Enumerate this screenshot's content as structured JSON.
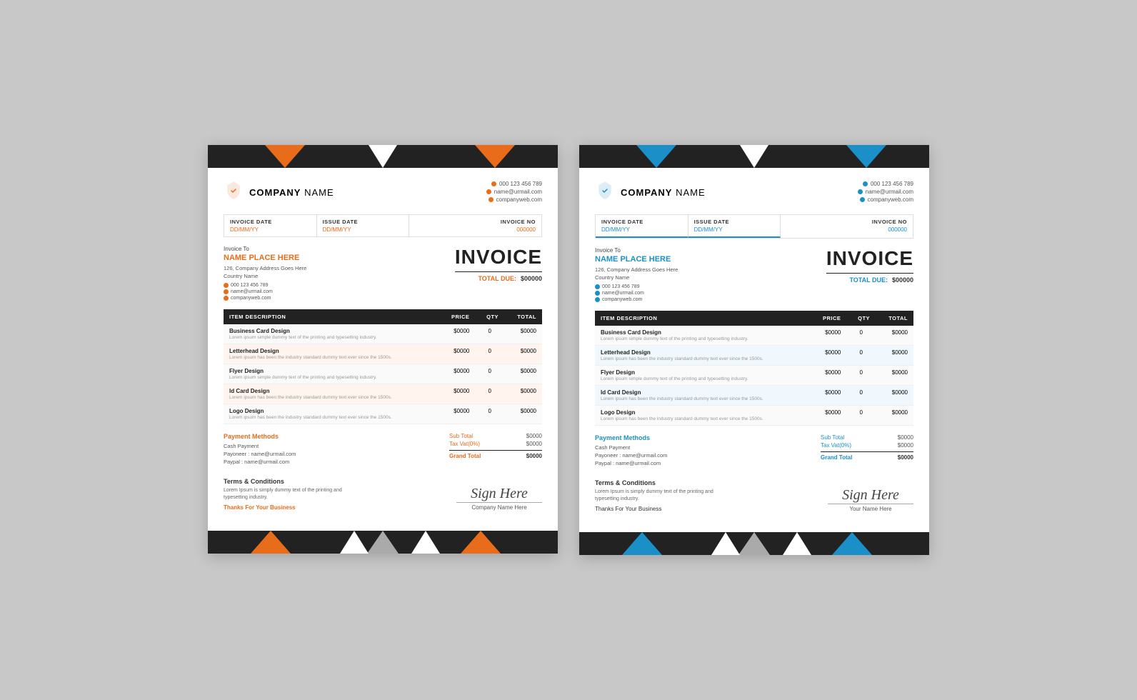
{
  "invoice_orange": {
    "company": {
      "name_bold": "COMPANY",
      "name_light": " NAME",
      "phone": "000 123 456 789",
      "email": "name@urmail.com",
      "web": "companyweb.com"
    },
    "dates": {
      "invoice_date_label": "INVOICE DATE",
      "invoice_date_value": "DD/MM/YY",
      "issue_date_label": "ISSUE DATE",
      "issue_date_value": "DD/MM/YY",
      "invoice_no_label": "INVOICE NO",
      "invoice_no_value": "000000"
    },
    "bill_to": {
      "label": "Invoice To",
      "name": "NAME PLACE HERE",
      "address1": "126, Company Address Goes Here",
      "address2": "Country Name",
      "phone": "000 123 456 789",
      "email": "name@urmail.com",
      "web": "companyweb.com"
    },
    "invoice_title": "INVOICE",
    "total_due_label": "TOTAL DUE:",
    "total_due_value": "$00000",
    "items": [
      {
        "name": "Business Card Design",
        "desc": "Lorem ipsum simple dummy text of the printing and typesetting industry.",
        "price": "$0000",
        "qty": "0",
        "total": "$0000"
      },
      {
        "name": "Letterhead Design",
        "desc": "Lorem ipsum has been the industry standard dummy text ever since the 1500s.",
        "price": "$0000",
        "qty": "0",
        "total": "$0000"
      },
      {
        "name": "Flyer Design",
        "desc": "Lorem ipsum simple dummy text of the printing and typesetting industry.",
        "price": "$0000",
        "qty": "0",
        "total": "$0000"
      },
      {
        "name": "Id Card Design",
        "desc": "Lorem ipsum has been the industry standard dummy text ever since the 1500s.",
        "price": "$0000",
        "qty": "0",
        "total": "$0000"
      },
      {
        "name": "Logo Design",
        "desc": "Lorem ipsum has been the industry standard dummy text ever since the 1500s.",
        "price": "$0000",
        "qty": "0",
        "total": "$0000"
      }
    ],
    "table_headers": {
      "description": "ITEM DESCRIPTION",
      "price": "PRICE",
      "qty": "QTY",
      "total": "TOTAL"
    },
    "payment": {
      "title": "Payment Methods",
      "cash": "Cash Payment",
      "payoneer_label": "Payoneer :",
      "payoneer_value": "name@urmail.com",
      "paypal_label": "Paypal :",
      "paypal_value": "name@urmail.com"
    },
    "totals": {
      "subtotal_label": "Sub Total",
      "subtotal_value": "$0000",
      "tax_label": "Tax Vat(0%)",
      "tax_value": "$0000",
      "grand_label": "Grand Total",
      "grand_value": "$0000"
    },
    "terms": {
      "title": "Terms & Conditions",
      "text": "Lorem Ipsum is simply dummy text of the printing and typesetting industry.",
      "thanks": "Thanks For Your Business"
    },
    "signature": {
      "sign": "Sign Here",
      "name": "Company Name Here"
    }
  },
  "invoice_blue": {
    "company": {
      "name_bold": "COMPANY",
      "name_light": " NAME",
      "phone": "000 123 456 789",
      "email": "name@urmail.com",
      "web": "companyweb.com"
    },
    "dates": {
      "invoice_date_label": "INVOICE DATE",
      "invoice_date_value": "DD/MM/YY",
      "issue_date_label": "ISSUE DATE",
      "issue_date_value": "DD/MM/YY",
      "invoice_no_label": "INVOICE NO",
      "invoice_no_value": "000000"
    },
    "bill_to": {
      "label": "Invoice To",
      "name": "NAME PLACE HERE",
      "address1": "126, Company Address Goes Here",
      "address2": "Country Name",
      "phone": "000 123 456 789",
      "email": "name@urmail.com",
      "web": "companyweb.com"
    },
    "invoice_title": "INVOICE",
    "total_due_label": "TOTAL DUE:",
    "total_due_value": "$00000",
    "items": [
      {
        "name": "Business Card Design",
        "desc": "Lorem ipsum simple dummy text of the printing and typesetting industry.",
        "price": "$0000",
        "qty": "0",
        "total": "$0000"
      },
      {
        "name": "Letterhead Design",
        "desc": "Lorem ipsum has been the industry standard dummy text ever since the 1500s.",
        "price": "$0000",
        "qty": "0",
        "total": "$0000"
      },
      {
        "name": "Flyer Design",
        "desc": "Lorem ipsum simple dummy text of the printing and typesetting industry.",
        "price": "$0000",
        "qty": "0",
        "total": "$0000"
      },
      {
        "name": "Id Card Design",
        "desc": "Lorem ipsum has been the industry standard dummy text ever since the 1500s.",
        "price": "$0000",
        "qty": "0",
        "total": "$0000"
      },
      {
        "name": "Logo Design",
        "desc": "Lorem ipsum has been the industry standard dummy text ever since the 1500s.",
        "price": "$0000",
        "qty": "0",
        "total": "$0000"
      }
    ],
    "table_headers": {
      "description": "ITEM DESCRIPTION",
      "price": "PRICE",
      "qty": "QTY",
      "total": "TOTAL"
    },
    "payment": {
      "title": "Payment Methods",
      "cash": "Cash Payment",
      "payoneer_label": "Payoneer :",
      "payoneer_value": "name@urmail.com",
      "paypal_label": "Paypal :",
      "paypal_value": "name@urmail.com"
    },
    "totals": {
      "subtotal_label": "Sub Total",
      "subtotal_value": "$0000",
      "tax_label": "Tax Vat(0%)",
      "tax_value": "$0000",
      "grand_label": "Grand Total",
      "grand_value": "$0000"
    },
    "terms": {
      "title": "Terms & Conditions",
      "text": "Lorem Ipsum is simply dummy text of the printing and typesetting industry.",
      "thanks": "Thanks For Your Business"
    },
    "signature": {
      "sign": "Sign Here",
      "name": "Your Name Here"
    }
  }
}
